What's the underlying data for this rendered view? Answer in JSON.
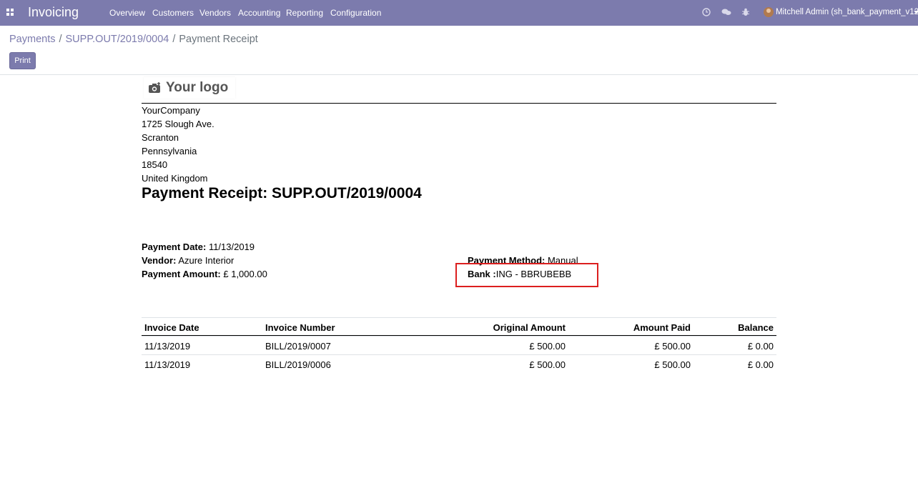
{
  "navbar": {
    "app_title": "Invoicing",
    "menu": [
      {
        "label": "Overview"
      },
      {
        "label": "Customers"
      },
      {
        "label": "Vendors"
      },
      {
        "label": "Accounting"
      },
      {
        "label": "Reporting"
      },
      {
        "label": "Configuration"
      }
    ],
    "user_name": "Mitchell Admin (sh_bank_payment_v12c)",
    "icons": [
      "apps-grid-icon",
      "clock-icon",
      "chat-icon",
      "bug-icon",
      "avatar",
      "caret-down-icon"
    ],
    "color": "#7c7bad"
  },
  "breadcrumb": {
    "items": [
      {
        "label": "Payments"
      },
      {
        "label": "SUPP.OUT/2019/0004"
      },
      {
        "label": "Payment Receipt"
      }
    ],
    "separator": "/"
  },
  "toolbar": {
    "print_label": "Print"
  },
  "report": {
    "logo_text": "Your logo",
    "address": [
      "YourCompany",
      "1725 Slough Ave.",
      "Scranton",
      "Pennsylvania",
      "18540",
      "United Kingdom"
    ],
    "title": "Payment Receipt: SUPP.OUT/2019/0004",
    "payment_date_label": "Payment Date:",
    "payment_date": "11/13/2019",
    "vendor_label": "Vendor:",
    "vendor": "Azure Interior",
    "amount_label": "Payment Amount:",
    "amount": "£ 1,000.00",
    "method_label": "Payment Method:",
    "method": "Manual",
    "bank_label": "Bank :",
    "bank": "ING - BBRUBEBB",
    "highlight_color": "#dc1f1f"
  },
  "table": {
    "headers": [
      "Invoice Date",
      "Invoice Number",
      "Original Amount",
      "Amount Paid",
      "Balance"
    ],
    "rows": [
      [
        "11/13/2019",
        "BILL/2019/0007",
        "£ 500.00",
        "£ 500.00",
        "£ 0.00"
      ],
      [
        "11/13/2019",
        "BILL/2019/0006",
        "£ 500.00",
        "£ 500.00",
        "£ 0.00"
      ]
    ]
  }
}
